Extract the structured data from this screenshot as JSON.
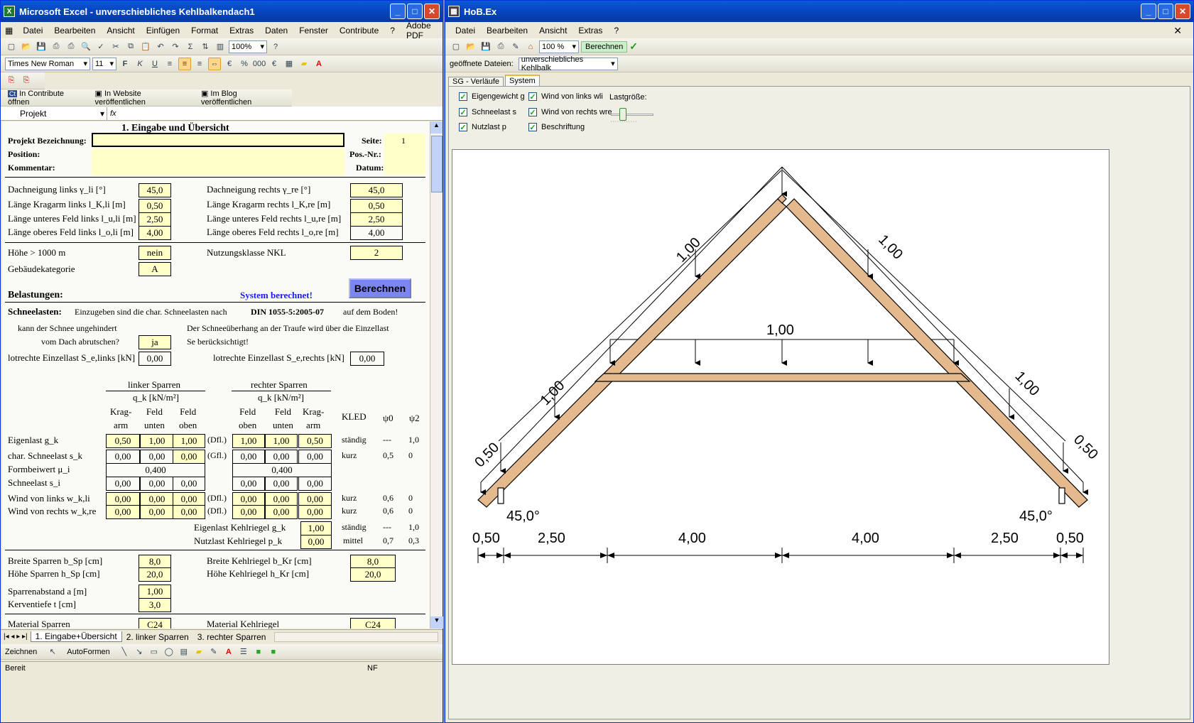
{
  "excel": {
    "title": "Microsoft Excel - unverschiebliches Kehlbalkendach1",
    "menu": [
      "Datei",
      "Bearbeiten",
      "Ansicht",
      "Einfügen",
      "Format",
      "Extras",
      "Daten",
      "Fenster",
      "Contribute",
      "?",
      "Adobe PDF"
    ],
    "zoom": "100%",
    "font": "Times New Roman",
    "font_size": "11",
    "contribute": {
      "open": "In Contribute öffnen",
      "website": "In Website veröffentlichen",
      "blog": "Im Blog veröffentlichen"
    },
    "name_box": "Projekt",
    "fx": "fx",
    "sheet": {
      "heading": "1. Eingabe und Übersicht",
      "proj_label": "Projekt Bezeichnung:",
      "position_label": "Position:",
      "kommentar_label": "Kommentar:",
      "seite_label": "Seite:",
      "seite_val": "1",
      "posnr_label": "Pos.-Nr.:",
      "datum_label": "Datum:",
      "dachneigung_links": "Dachneigung links γ_li [°]",
      "dachneigung_links_v": "45,0",
      "dachneigung_rechts": "Dachneigung rechts γ_re [°]",
      "dachneigung_rechts_v": "45,0",
      "krag_links": "Länge Kragarm links l_K,li [m]",
      "krag_links_v": "0,50",
      "krag_rechts": "Länge Kragarm rechts l_K,re [m]",
      "krag_rechts_v": "0,50",
      "unt_links": "Länge unteres Feld links l_u,li [m]",
      "unt_links_v": "2,50",
      "unt_rechts": "Länge unteres Feld rechts l_u,re [m]",
      "unt_rechts_v": "2,50",
      "ob_links": "Länge oberes Feld links l_o,li [m]",
      "ob_links_v": "4,00",
      "ob_rechts": "Länge oberes Feld rechts l_o,re [m]",
      "ob_rechts_v": "4,00",
      "hoehe": "Höhe > 1000 m",
      "hoehe_v": "nein",
      "nkl": "Nutzungsklasse NKL",
      "nkl_v": "2",
      "gebkat": "Gebäudekategorie",
      "gebkat_v": "A",
      "belastungen": "Belastungen:",
      "berechnet": "System berechnet!",
      "berechnen_btn": "Berechnen",
      "schnee_label": "Schneelasten:",
      "schnee_text": "Einzugeben sind die char. Schneelasten nach",
      "din": "DIN 1055-5:2005-07",
      "auf_boden": "auf dem Boden!",
      "abrutschen1": "kann der Schnee ungehindert",
      "abrutschen2": "vom Dach abrutschen?",
      "abrutschen_v": "ja",
      "ueberhang1": "Der Schneeüberhang an der Traufe wird über die Einzellast",
      "ueberhang2": "Se berücksichtigt!",
      "einzel_li": "lotrechte Einzellast S_e,links [kN]",
      "einzel_li_v": "0,00",
      "einzel_re": "lotrechte Einzellast S_e,rechts [kN]",
      "einzel_re_v": "0,00",
      "linker": "linker Sparren",
      "rechter": "rechter Sparren",
      "qk": "q_k [kN/m²]",
      "cols_l": [
        "Krag-\narm",
        "Feld\nunten",
        "Feld\noben"
      ],
      "cols_r": [
        "Feld\noben",
        "Feld\nunten",
        "Krag-\narm"
      ],
      "kled": "KLED",
      "psi0": "ψ0",
      "psi2": "ψ2",
      "rows": [
        {
          "label": "Eigenlast g_k",
          "l": [
            "0,50",
            "1,00",
            "1,00"
          ],
          "mid": "(Dfl.)",
          "r": [
            "1,00",
            "1,00",
            "0,50"
          ],
          "kled": "ständig",
          "p0": "---",
          "p2": "1,0"
        },
        {
          "label": "char. Schneelast s_k",
          "l": [
            "0,00",
            "0,00",
            "0,00"
          ],
          "mid": "(Gfl.)",
          "r": [
            "0,00",
            "0,00",
            "0,00"
          ],
          "kled": "kurz",
          "p0": "0,5",
          "p2": "0"
        },
        {
          "label": "Formbeiwert μ_i",
          "l": [
            "0,400"
          ],
          "mid": "",
          "r": [
            "0,400"
          ],
          "kled": "",
          "p0": "",
          "p2": ""
        },
        {
          "label": "Schneelast s_i",
          "l": [
            "0,00",
            "0,00",
            "0,00"
          ],
          "mid": "",
          "r": [
            "0,00",
            "0,00",
            "0,00"
          ],
          "kled": "",
          "p0": "",
          "p2": ""
        },
        {
          "label": "Wind von links w_k,li",
          "l": [
            "0,00",
            "0,00",
            "0,00"
          ],
          "mid": "(Dfl.)",
          "r": [
            "0,00",
            "0,00",
            "0,00"
          ],
          "kled": "kurz",
          "p0": "0,6",
          "p2": "0"
        },
        {
          "label": "Wind von rechts w_k,re",
          "l": [
            "0,00",
            "0,00",
            "0,00"
          ],
          "mid": "(Dfl.)",
          "r": [
            "0,00",
            "0,00",
            "0,00"
          ],
          "kled": "kurz",
          "p0": "0,6",
          "p2": "0"
        }
      ],
      "kehl_eigen": "Eigenlast Kehlriegel g_k",
      "kehl_eigen_v": "1,00",
      "kehl_eigen_kled": "ständig",
      "kehl_eigen_p0": "---",
      "kehl_eigen_p2": "1,0",
      "kehl_nutz": "Nutzlast Kehlriegel p_k",
      "kehl_nutz_v": "0,00",
      "kehl_nutz_kled": "mittel",
      "kehl_nutz_p0": "0,7",
      "kehl_nutz_p2": "0,3",
      "breite_sp": "Breite Sparren b_Sp [cm]",
      "breite_sp_v": "8,0",
      "breite_kr": "Breite Kehlriegel b_Kr [cm]",
      "breite_kr_v": "8,0",
      "hoehe_sp": "Höhe Sparren h_Sp [cm]",
      "hoehe_sp_v": "20,0",
      "hoehe_kr": "Höhe Kehlriegel h_Kr [cm]",
      "hoehe_kr_v": "20,0",
      "abstand": "Sparrenabstand a [m]",
      "abstand_v": "1,00",
      "kerv": "Kerventiefe t [cm]",
      "kerv_v": "3,0",
      "mat_sp": "Material Sparren",
      "mat_sp_v": "C24",
      "mat_kr": "Material Kehlriegel",
      "mat_kr_v": "C24"
    },
    "tabs": [
      "1. Eingabe+Übersicht",
      "2. linker Sparren",
      "3. rechter Sparren"
    ],
    "draw": {
      "zeichnen": "Zeichnen",
      "autoformen": "AutoFormen"
    },
    "status": "Bereit",
    "status_nf": "NF"
  },
  "hobex": {
    "title": "HoB.Ex",
    "menu": [
      "Datei",
      "Bearbeiten",
      "Ansicht",
      "Extras",
      "?"
    ],
    "zoom": "100 %",
    "berechnen": "Berechnen",
    "files_label": "geöffnete Dateien:",
    "files_val": "unverschiebliches Kehlbalk",
    "tabs": [
      "SG - Verläufe",
      "System"
    ],
    "checks": [
      {
        "label": "Eigengewicht g",
        "checked": true
      },
      {
        "label": "Schneelast s",
        "checked": true
      },
      {
        "label": "Nutzlast p",
        "checked": true
      },
      {
        "label": "Wind von links wli",
        "checked": true
      },
      {
        "label": "Wind von rechts wre",
        "checked": true
      },
      {
        "label": "Beschriftung",
        "checked": true
      }
    ],
    "lastgroesse": "Lastgröße:",
    "diagram": {
      "load_top_left": "1,00",
      "load_top_right": "1,00",
      "load_kehl": "1,00",
      "load_low_left": "1,00",
      "load_low_right": "1,00",
      "load_krag_left": "0,50",
      "load_krag_right": "0,50",
      "angle_left": "45,0°",
      "angle_right": "45,0°",
      "dims": [
        "0,50",
        "2,50",
        "4,00",
        "4,00",
        "2,50",
        "0,50"
      ]
    }
  }
}
